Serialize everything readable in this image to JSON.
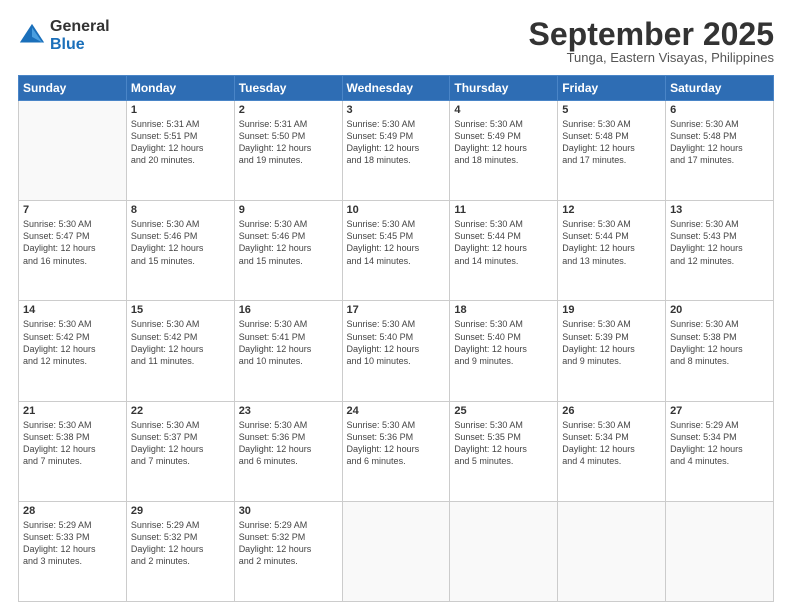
{
  "header": {
    "logo_line1": "General",
    "logo_line2": "Blue",
    "month": "September 2025",
    "location": "Tunga, Eastern Visayas, Philippines"
  },
  "weekdays": [
    "Sunday",
    "Monday",
    "Tuesday",
    "Wednesday",
    "Thursday",
    "Friday",
    "Saturday"
  ],
  "weeks": [
    [
      {
        "day": "",
        "info": ""
      },
      {
        "day": "1",
        "info": "Sunrise: 5:31 AM\nSunset: 5:51 PM\nDaylight: 12 hours\nand 20 minutes."
      },
      {
        "day": "2",
        "info": "Sunrise: 5:31 AM\nSunset: 5:50 PM\nDaylight: 12 hours\nand 19 minutes."
      },
      {
        "day": "3",
        "info": "Sunrise: 5:30 AM\nSunset: 5:49 PM\nDaylight: 12 hours\nand 18 minutes."
      },
      {
        "day": "4",
        "info": "Sunrise: 5:30 AM\nSunset: 5:49 PM\nDaylight: 12 hours\nand 18 minutes."
      },
      {
        "day": "5",
        "info": "Sunrise: 5:30 AM\nSunset: 5:48 PM\nDaylight: 12 hours\nand 17 minutes."
      },
      {
        "day": "6",
        "info": "Sunrise: 5:30 AM\nSunset: 5:48 PM\nDaylight: 12 hours\nand 17 minutes."
      }
    ],
    [
      {
        "day": "7",
        "info": "Sunrise: 5:30 AM\nSunset: 5:47 PM\nDaylight: 12 hours\nand 16 minutes."
      },
      {
        "day": "8",
        "info": "Sunrise: 5:30 AM\nSunset: 5:46 PM\nDaylight: 12 hours\nand 15 minutes."
      },
      {
        "day": "9",
        "info": "Sunrise: 5:30 AM\nSunset: 5:46 PM\nDaylight: 12 hours\nand 15 minutes."
      },
      {
        "day": "10",
        "info": "Sunrise: 5:30 AM\nSunset: 5:45 PM\nDaylight: 12 hours\nand 14 minutes."
      },
      {
        "day": "11",
        "info": "Sunrise: 5:30 AM\nSunset: 5:44 PM\nDaylight: 12 hours\nand 14 minutes."
      },
      {
        "day": "12",
        "info": "Sunrise: 5:30 AM\nSunset: 5:44 PM\nDaylight: 12 hours\nand 13 minutes."
      },
      {
        "day": "13",
        "info": "Sunrise: 5:30 AM\nSunset: 5:43 PM\nDaylight: 12 hours\nand 12 minutes."
      }
    ],
    [
      {
        "day": "14",
        "info": "Sunrise: 5:30 AM\nSunset: 5:42 PM\nDaylight: 12 hours\nand 12 minutes."
      },
      {
        "day": "15",
        "info": "Sunrise: 5:30 AM\nSunset: 5:42 PM\nDaylight: 12 hours\nand 11 minutes."
      },
      {
        "day": "16",
        "info": "Sunrise: 5:30 AM\nSunset: 5:41 PM\nDaylight: 12 hours\nand 10 minutes."
      },
      {
        "day": "17",
        "info": "Sunrise: 5:30 AM\nSunset: 5:40 PM\nDaylight: 12 hours\nand 10 minutes."
      },
      {
        "day": "18",
        "info": "Sunrise: 5:30 AM\nSunset: 5:40 PM\nDaylight: 12 hours\nand 9 minutes."
      },
      {
        "day": "19",
        "info": "Sunrise: 5:30 AM\nSunset: 5:39 PM\nDaylight: 12 hours\nand 9 minutes."
      },
      {
        "day": "20",
        "info": "Sunrise: 5:30 AM\nSunset: 5:38 PM\nDaylight: 12 hours\nand 8 minutes."
      }
    ],
    [
      {
        "day": "21",
        "info": "Sunrise: 5:30 AM\nSunset: 5:38 PM\nDaylight: 12 hours\nand 7 minutes."
      },
      {
        "day": "22",
        "info": "Sunrise: 5:30 AM\nSunset: 5:37 PM\nDaylight: 12 hours\nand 7 minutes."
      },
      {
        "day": "23",
        "info": "Sunrise: 5:30 AM\nSunset: 5:36 PM\nDaylight: 12 hours\nand 6 minutes."
      },
      {
        "day": "24",
        "info": "Sunrise: 5:30 AM\nSunset: 5:36 PM\nDaylight: 12 hours\nand 6 minutes."
      },
      {
        "day": "25",
        "info": "Sunrise: 5:30 AM\nSunset: 5:35 PM\nDaylight: 12 hours\nand 5 minutes."
      },
      {
        "day": "26",
        "info": "Sunrise: 5:30 AM\nSunset: 5:34 PM\nDaylight: 12 hours\nand 4 minutes."
      },
      {
        "day": "27",
        "info": "Sunrise: 5:29 AM\nSunset: 5:34 PM\nDaylight: 12 hours\nand 4 minutes."
      }
    ],
    [
      {
        "day": "28",
        "info": "Sunrise: 5:29 AM\nSunset: 5:33 PM\nDaylight: 12 hours\nand 3 minutes."
      },
      {
        "day": "29",
        "info": "Sunrise: 5:29 AM\nSunset: 5:32 PM\nDaylight: 12 hours\nand 2 minutes."
      },
      {
        "day": "30",
        "info": "Sunrise: 5:29 AM\nSunset: 5:32 PM\nDaylight: 12 hours\nand 2 minutes."
      },
      {
        "day": "",
        "info": ""
      },
      {
        "day": "",
        "info": ""
      },
      {
        "day": "",
        "info": ""
      },
      {
        "day": "",
        "info": ""
      }
    ]
  ]
}
